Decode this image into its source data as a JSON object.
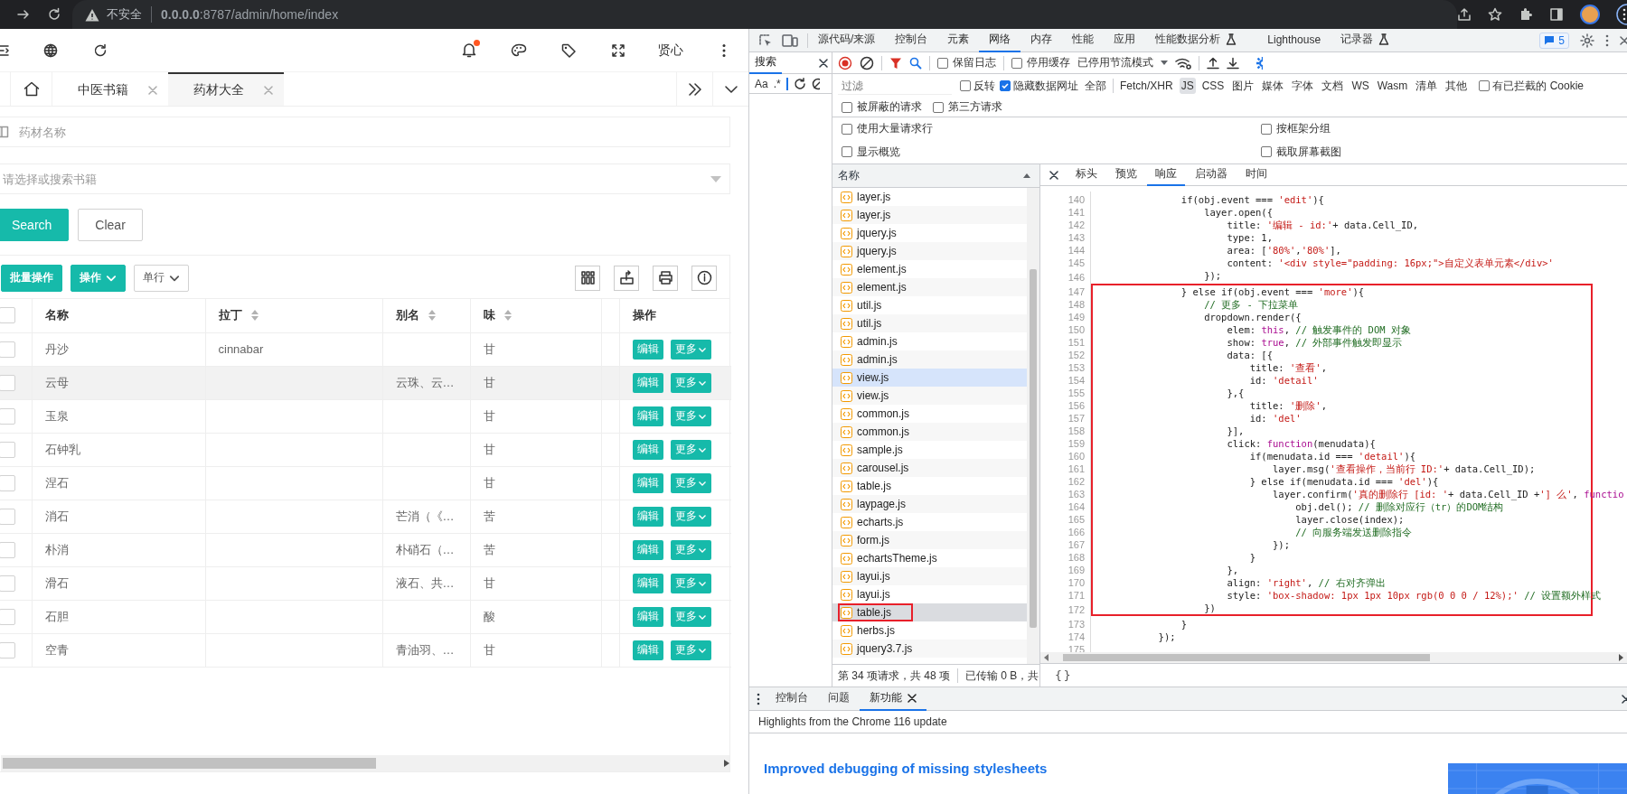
{
  "browser": {
    "security": "不安全",
    "address": "**0.0.0.0**:8787/admin/home/index"
  },
  "app": {
    "header": {
      "user": "贤心",
      "notification_dot": true
    },
    "tabs": [
      {
        "label": "中医书籍",
        "selected": false
      },
      {
        "label": "药材大全",
        "selected": true
      }
    ],
    "name_field": {
      "placeholder": "药材名称"
    },
    "book_select": {
      "placeholder": "请选择或搜索书籍"
    },
    "form_buttons": [
      {
        "label": "Search",
        "kind": "primary"
      },
      {
        "label": "Clear",
        "kind": "default"
      }
    ],
    "toolbar": [
      {
        "label": "批量操作",
        "kind": "primary"
      },
      {
        "label": "操作",
        "kind": "primary-dropdown"
      },
      {
        "label": "单行",
        "kind": "dropdown"
      }
    ],
    "table": {
      "columns": [
        {
          "label": "名称",
          "sortable": false
        },
        {
          "label": "拉丁",
          "sortable": true
        },
        {
          "label": "别名",
          "sortable": true
        },
        {
          "label": "味",
          "sortable": true
        }
      ],
      "action_column": "操作",
      "all_checked": false,
      "rows": [
        {
          "checked": false,
          "highlighted": false,
          "name": "丹沙",
          "latin": "cinnabar",
          "taste": "甘",
          "actions": [
            "编辑",
            "更多"
          ]
        },
        {
          "checked": false,
          "highlighted": true,
          "name": "云母",
          "alias": "云珠、云…",
          "taste": "甘",
          "actions": [
            "编辑",
            "更多"
          ]
        },
        {
          "checked": false,
          "highlighted": false,
          "name": "玉泉",
          "taste": "甘",
          "actions": [
            "编辑",
            "更多"
          ]
        },
        {
          "checked": false,
          "highlighted": false,
          "name": "石钟乳",
          "taste": "甘",
          "actions": [
            "编辑",
            "更多"
          ]
        },
        {
          "checked": false,
          "highlighted": false,
          "name": "涅石",
          "taste": "甘",
          "actions": [
            "编辑",
            "更多"
          ]
        },
        {
          "checked": false,
          "highlighted": false,
          "name": "消石",
          "alias": "芒消（《…",
          "taste": "苦",
          "actions": [
            "编辑",
            "更多"
          ]
        },
        {
          "checked": false,
          "highlighted": false,
          "name": "朴消",
          "alias": "朴硝石（…",
          "taste": "苦",
          "actions": [
            "编辑",
            "更多"
          ]
        },
        {
          "checked": false,
          "highlighted": false,
          "name": "滑石",
          "alias": "液石、共…",
          "taste": "甘",
          "actions": [
            "编辑",
            "更多"
          ]
        },
        {
          "checked": false,
          "highlighted": false,
          "name": "石胆",
          "taste": "酸",
          "actions": [
            "编辑",
            "更多"
          ]
        },
        {
          "checked": false,
          "highlighted": false,
          "name": "空青",
          "alias": "青油羽、…",
          "taste": "甘",
          "actions": [
            "编辑",
            "更多"
          ]
        }
      ]
    }
  },
  "devtools": {
    "tabs": [
      {
        "label": "源代码/来源",
        "selected": false
      },
      {
        "label": "控制台",
        "selected": false
      },
      {
        "label": "元素",
        "selected": false
      },
      {
        "label": "网络",
        "selected": true
      },
      {
        "label": "内存",
        "selected": false
      },
      {
        "label": "性能",
        "selected": false
      },
      {
        "label": "应用",
        "selected": false
      },
      {
        "label": "性能数据分析",
        "selected": false,
        "experimental": true
      },
      {
        "label": "Lighthouse",
        "selected": false
      },
      {
        "label": "记录器",
        "selected": false,
        "experimental": true
      }
    ],
    "message_count": "5",
    "search_panel": {
      "title": "搜索",
      "options": [
        "Aa",
        ".*"
      ]
    },
    "network": {
      "toolbar_checkboxes": [
        {
          "label": "保留日志",
          "checked": false
        },
        {
          "label": "停用缓存",
          "checked": false
        }
      ],
      "throttling": "已停用节流模式",
      "filter": {
        "placeholder": "过滤"
      },
      "filter_checkboxes": [
        {
          "label": "反转",
          "checked": false
        },
        {
          "label": "隐藏数据网址",
          "checked": true
        }
      ],
      "types": [
        {
          "label": "全部",
          "selected": false
        },
        {
          "label": "Fetch/XHR",
          "selected": false
        },
        {
          "label": "JS",
          "selected": true
        },
        {
          "label": "CSS",
          "selected": false
        },
        {
          "label": "图片",
          "selected": false
        },
        {
          "label": "媒体",
          "selected": false
        },
        {
          "label": "字体",
          "selected": false
        },
        {
          "label": "文档",
          "selected": false
        },
        {
          "label": "WS",
          "selected": false
        },
        {
          "label": "Wasm",
          "selected": false
        },
        {
          "label": "清单",
          "selected": false
        },
        {
          "label": "其他",
          "selected": false
        }
      ],
      "cookie_checkbox": {
        "label": "有已拦截的 Cookie",
        "checked": false
      },
      "request_checkboxes": [
        {
          "label": "被屏蔽的请求",
          "checked": false
        },
        {
          "label": "第三方请求",
          "checked": false
        }
      ],
      "settings": [
        {
          "label": "使用大量请求行",
          "checked": false
        },
        {
          "label": "按框架分组",
          "checked": false
        },
        {
          "label": "显示概览",
          "checked": false
        },
        {
          "label": "截取屏幕截图",
          "checked": false
        }
      ],
      "name_header": "名称",
      "files": [
        {
          "name": "layer.js",
          "selected": false,
          "highlighted": false,
          "marked": false
        },
        {
          "name": "layer.js",
          "selected": false,
          "highlighted": false,
          "marked": false
        },
        {
          "name": "jquery.js",
          "selected": false,
          "highlighted": false,
          "marked": false
        },
        {
          "name": "jquery.js",
          "selected": false,
          "highlighted": false,
          "marked": false
        },
        {
          "name": "element.js",
          "selected": false,
          "highlighted": false,
          "marked": false
        },
        {
          "name": "element.js",
          "selected": false,
          "highlighted": false,
          "marked": false
        },
        {
          "name": "util.js",
          "selected": false,
          "highlighted": false,
          "marked": false
        },
        {
          "name": "util.js",
          "selected": false,
          "highlighted": false,
          "marked": false
        },
        {
          "name": "admin.js",
          "selected": false,
          "highlighted": false,
          "marked": false
        },
        {
          "name": "admin.js",
          "selected": false,
          "highlighted": false,
          "marked": false
        },
        {
          "name": "view.js",
          "selected": false,
          "highlighted": true,
          "marked": false
        },
        {
          "name": "view.js",
          "selected": false,
          "highlighted": false,
          "marked": false
        },
        {
          "name": "common.js",
          "selected": false,
          "highlighted": false,
          "marked": false
        },
        {
          "name": "common.js",
          "selected": false,
          "highlighted": false,
          "marked": false
        },
        {
          "name": "sample.js",
          "selected": false,
          "highlighted": false,
          "marked": false
        },
        {
          "name": "carousel.js",
          "selected": false,
          "highlighted": false,
          "marked": false
        },
        {
          "name": "table.js",
          "selected": false,
          "highlighted": false,
          "marked": false
        },
        {
          "name": "laypage.js",
          "selected": false,
          "highlighted": false,
          "marked": false
        },
        {
          "name": "echarts.js",
          "selected": false,
          "highlighted": false,
          "marked": false
        },
        {
          "name": "form.js",
          "selected": false,
          "highlighted": false,
          "marked": false
        },
        {
          "name": "echartsTheme.js",
          "selected": false,
          "highlighted": false,
          "marked": false
        },
        {
          "name": "layui.js",
          "selected": false,
          "highlighted": false,
          "marked": false
        },
        {
          "name": "layui.js",
          "selected": false,
          "highlighted": false,
          "marked": false
        },
        {
          "name": "table.js",
          "selected": true,
          "highlighted": false,
          "marked": true
        },
        {
          "name": "herbs.js",
          "selected": false,
          "highlighted": false,
          "marked": false
        },
        {
          "name": "jquery3.7.js",
          "selected": false,
          "highlighted": false,
          "marked": false
        }
      ],
      "status": "第 34 项请求，共 48 项",
      "transferred": "已传输 0 B，共",
      "detail_tabs": [
        {
          "label": "标头",
          "selected": false
        },
        {
          "label": "预览",
          "selected": false
        },
        {
          "label": "响应",
          "selected": true
        },
        {
          "label": "启动器",
          "selected": false
        },
        {
          "label": "时间",
          "selected": false
        }
      ],
      "pretty_print": "{}",
      "code_blocks": [
        {
          "boxed": false,
          "lines": [
            {
              "number": "140",
              "tokens": [
                {
                  "kind": "plain",
                  "text": "            if(obj.event === "
                },
                {
                  "kind": "string",
                  "text": "'edit'"
                },
                {
                  "kind": "plain",
                  "text": "){"
                }
              ]
            },
            {
              "number": "141",
              "tokens": [
                {
                  "kind": "plain",
                  "text": "                layer.open({"
                }
              ]
            },
            {
              "number": "142",
              "tokens": [
                {
                  "kind": "plain",
                  "text": "                    title: "
                },
                {
                  "kind": "string",
                  "text": "'编辑 - id:'"
                },
                {
                  "kind": "plain",
                  "text": "+ data.Cell_ID,"
                }
              ]
            },
            {
              "number": "143",
              "tokens": [
                {
                  "kind": "plain",
                  "text": "                    type: 1,"
                }
              ]
            },
            {
              "number": "144",
              "tokens": [
                {
                  "kind": "plain",
                  "text": "                    area: ["
                },
                {
                  "kind": "string",
                  "text": "'80%'"
                },
                {
                  "kind": "plain",
                  "text": ","
                },
                {
                  "kind": "string",
                  "text": "'80%'"
                },
                {
                  "kind": "plain",
                  "text": "],"
                }
              ]
            },
            {
              "number": "145",
              "tokens": [
                {
                  "kind": "plain",
                  "text": "                    content: "
                },
                {
                  "kind": "string",
                  "text": "'<div style=\"padding: 16px;\">自定义表单元素</div>'"
                }
              ]
            },
            {
              "number": "146",
              "tokens": [
                {
                  "kind": "plain",
                  "text": "                });"
                }
              ]
            }
          ]
        },
        {
          "boxed": true,
          "lines": [
            {
              "number": "147",
              "tokens": [
                {
                  "kind": "plain",
                  "text": "            } else if(obj.event === "
                },
                {
                  "kind": "string",
                  "text": "'more'"
                },
                {
                  "kind": "plain",
                  "text": "){"
                }
              ]
            },
            {
              "number": "148",
              "tokens": [
                {
                  "kind": "comment",
                  "text": "                // 更多 - 下拉菜单"
                }
              ]
            },
            {
              "number": "149",
              "tokens": [
                {
                  "kind": "plain",
                  "text": "                dropdown.render({"
                }
              ]
            },
            {
              "number": "150",
              "tokens": [
                {
                  "kind": "plain",
                  "text": "                    elem: "
                },
                {
                  "kind": "keyword",
                  "text": "this"
                },
                {
                  "kind": "plain",
                  "text": ", "
                },
                {
                  "kind": "comment",
                  "text": "// 触发事件的 DOM 对象"
                }
              ]
            },
            {
              "number": "151",
              "tokens": [
                {
                  "kind": "plain",
                  "text": "                    show: "
                },
                {
                  "kind": "keyword",
                  "text": "true"
                },
                {
                  "kind": "plain",
                  "text": ", "
                },
                {
                  "kind": "comment",
                  "text": "// 外部事件触发即显示"
                }
              ]
            },
            {
              "number": "152",
              "tokens": [
                {
                  "kind": "plain",
                  "text": "                    data: [{"
                }
              ]
            },
            {
              "number": "153",
              "tokens": [
                {
                  "kind": "plain",
                  "text": "                        title: "
                },
                {
                  "kind": "string",
                  "text": "'查看'"
                },
                {
                  "kind": "plain",
                  "text": ","
                }
              ]
            },
            {
              "number": "154",
              "tokens": [
                {
                  "kind": "plain",
                  "text": "                        id: "
                },
                {
                  "kind": "string",
                  "text": "'detail'"
                }
              ]
            },
            {
              "number": "155",
              "tokens": [
                {
                  "kind": "plain",
                  "text": "                    },{"
                }
              ]
            },
            {
              "number": "156",
              "tokens": [
                {
                  "kind": "plain",
                  "text": "                        title: "
                },
                {
                  "kind": "string",
                  "text": "'删除'"
                },
                {
                  "kind": "plain",
                  "text": ","
                }
              ]
            },
            {
              "number": "157",
              "tokens": [
                {
                  "kind": "plain",
                  "text": "                        id: "
                },
                {
                  "kind": "string",
                  "text": "'del'"
                }
              ]
            },
            {
              "number": "158",
              "tokens": [
                {
                  "kind": "plain",
                  "text": "                    }],"
                }
              ]
            },
            {
              "number": "159",
              "tokens": [
                {
                  "kind": "plain",
                  "text": "                    click: "
                },
                {
                  "kind": "keyword",
                  "text": "function"
                },
                {
                  "kind": "plain",
                  "text": "(menudata){"
                }
              ]
            },
            {
              "number": "160",
              "tokens": [
                {
                  "kind": "plain",
                  "text": "                        if(menudata.id === "
                },
                {
                  "kind": "string",
                  "text": "'detail'"
                },
                {
                  "kind": "plain",
                  "text": "){"
                }
              ]
            },
            {
              "number": "161",
              "tokens": [
                {
                  "kind": "plain",
                  "text": "                            layer.msg("
                },
                {
                  "kind": "string",
                  "text": "'查看操作，当前行 ID:'"
                },
                {
                  "kind": "plain",
                  "text": "+ data.Cell_ID);"
                }
              ]
            },
            {
              "number": "162",
              "tokens": [
                {
                  "kind": "plain",
                  "text": "                        } else if(menudata.id === "
                },
                {
                  "kind": "string",
                  "text": "'del'"
                },
                {
                  "kind": "plain",
                  "text": "){"
                }
              ]
            },
            {
              "number": "163",
              "tokens": [
                {
                  "kind": "plain",
                  "text": "                            layer.confirm("
                },
                {
                  "kind": "string",
                  "text": "'真的删除行 [id: '"
                },
                {
                  "kind": "plain",
                  "text": "+ data.Cell_ID +"
                },
                {
                  "kind": "string",
                  "text": "'] 么'"
                },
                {
                  "kind": "plain",
                  "text": ", "
                },
                {
                  "kind": "keyword",
                  "text": "functio"
                }
              ]
            },
            {
              "number": "164",
              "tokens": [
                {
                  "kind": "plain",
                  "text": "                                obj.del(); "
                },
                {
                  "kind": "comment",
                  "text": "// 删除对应行（tr）的DOM结构"
                }
              ]
            },
            {
              "number": "165",
              "tokens": [
                {
                  "kind": "plain",
                  "text": "                                layer.close(index);"
                }
              ]
            },
            {
              "number": "166",
              "tokens": [
                {
                  "kind": "comment",
                  "text": "                                // 向服务端发送删除指令"
                }
              ]
            },
            {
              "number": "167",
              "tokens": [
                {
                  "kind": "plain",
                  "text": "                            });"
                }
              ]
            },
            {
              "number": "168",
              "tokens": [
                {
                  "kind": "plain",
                  "text": "                        }"
                }
              ]
            },
            {
              "number": "169",
              "tokens": [
                {
                  "kind": "plain",
                  "text": "                    },"
                }
              ]
            },
            {
              "number": "170",
              "tokens": [
                {
                  "kind": "plain",
                  "text": "                    align: "
                },
                {
                  "kind": "string",
                  "text": "'right'"
                },
                {
                  "kind": "plain",
                  "text": ", "
                },
                {
                  "kind": "comment",
                  "text": "// 右对齐弹出"
                }
              ]
            },
            {
              "number": "171",
              "tokens": [
                {
                  "kind": "plain",
                  "text": "                    style: "
                },
                {
                  "kind": "string",
                  "text": "'box-shadow: 1px 1px 10px rgb(0 0 0 / 12%);'"
                },
                {
                  "kind": "comment",
                  "text": " // 设置额外样式"
                }
              ]
            },
            {
              "number": "172",
              "tokens": [
                {
                  "kind": "plain",
                  "text": "                })"
                }
              ]
            }
          ]
        },
        {
          "boxed": false,
          "lines": [
            {
              "number": "173",
              "tokens": [
                {
                  "kind": "plain",
                  "text": "            }"
                }
              ]
            },
            {
              "number": "174",
              "tokens": [
                {
                  "kind": "plain",
                  "text": "        });"
                }
              ]
            },
            {
              "number": "175"
            }
          ]
        }
      ]
    },
    "drawer": {
      "tabs": [
        {
          "label": "控制台",
          "selected": false,
          "closable": false
        },
        {
          "label": "问题",
          "selected": false,
          "closable": false
        },
        {
          "label": "新功能",
          "selected": true,
          "closable": true
        }
      ],
      "subtitle": "Highlights from the Chrome 116 update",
      "headline": "Improved debugging of missing stylesheets"
    }
  }
}
